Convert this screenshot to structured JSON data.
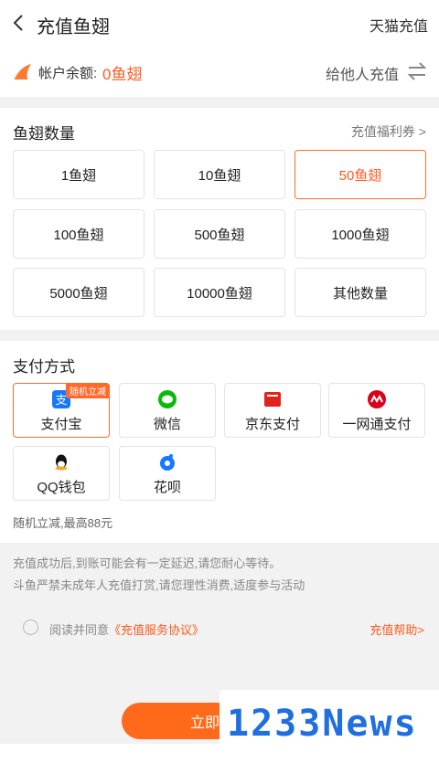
{
  "header": {
    "title": "充值鱼翅",
    "tmall_label": "天猫充值"
  },
  "balance": {
    "label": "帐户余额:",
    "value": "0鱼翅",
    "gift_label": "给他人充值"
  },
  "amount_section": {
    "title": "鱼翅数量",
    "coupon_label": "充值福利券 >",
    "options": [
      "1鱼翅",
      "10鱼翅",
      "50鱼翅",
      "100鱼翅",
      "500鱼翅",
      "1000鱼翅",
      "5000鱼翅",
      "10000鱼翅",
      "其他数量"
    ],
    "selected": "50鱼翅"
  },
  "payment_section": {
    "title": "支付方式",
    "methods": [
      "支付宝",
      "微信",
      "京东支付",
      "一网通支付",
      "QQ钱包",
      "花呗"
    ],
    "selected": "支付宝",
    "badge": "随机立减",
    "promo": "随机立减,最高88元"
  },
  "notices": [
    "充值成功后,到账可能会有一定延迟,请您耐心等待。",
    "斗鱼严禁未成年人充值打赏,请您理性消费,适度参与活动"
  ],
  "agreement": {
    "prefix": "阅读并同意",
    "link": "《充值服务协议》",
    "help": "充值帮助>"
  },
  "cta": {
    "label": "立即支付"
  },
  "watermark": {
    "text": "1233News"
  },
  "colors": {
    "accent": "#ff6a2b",
    "alipay": "#1677ff",
    "wechat": "#09bb07",
    "jd": "#e1251b",
    "cmb": "#d9001b"
  },
  "icons": [
    "back-arrow-icon",
    "fin-icon",
    "swap-icon",
    "alipay-icon",
    "wechat-icon",
    "jd-pay-icon",
    "cmb-icon",
    "qq-icon",
    "huabei-icon"
  ]
}
